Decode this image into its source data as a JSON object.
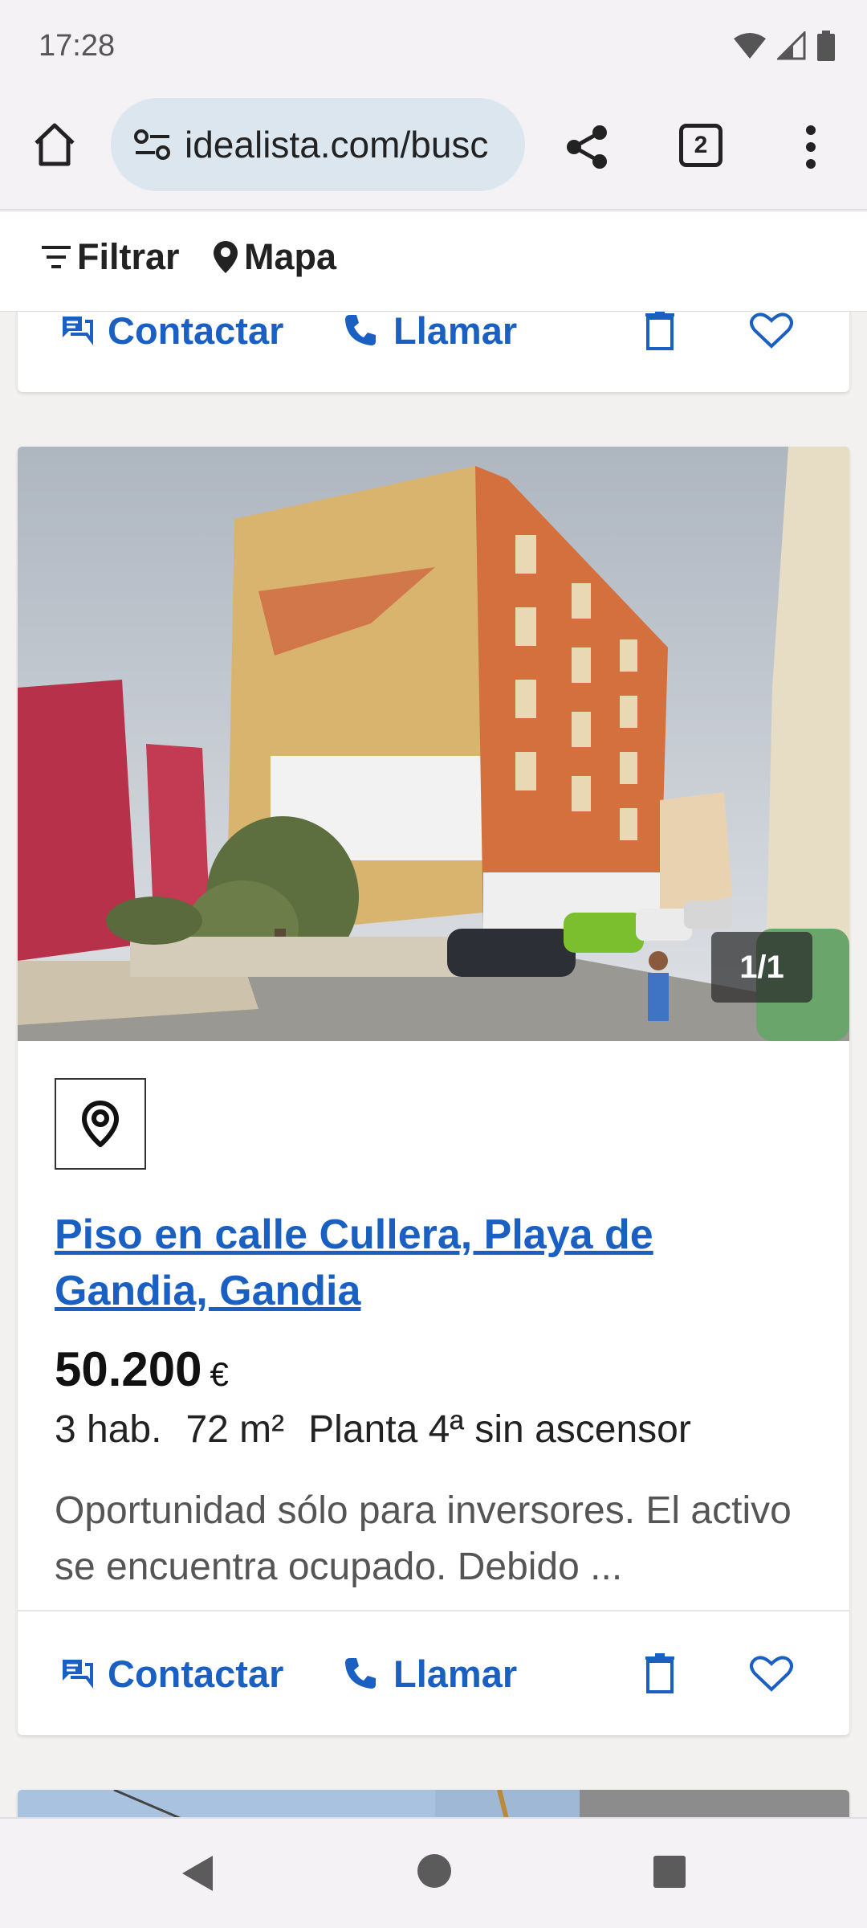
{
  "status_bar": {
    "time": "17:28"
  },
  "browser": {
    "url": "idealista.com/busc",
    "tab_count": "2"
  },
  "filter_bar": {
    "filter_label": "Filtrar",
    "map_label": "Mapa"
  },
  "previous_card": {
    "contact_label": "Contactar",
    "call_label": "Llamar"
  },
  "listing": {
    "photo_counter": "1/1",
    "title": "Piso en calle Cullera, Playa de Gandia, Gandia",
    "price": "50.200",
    "currency": "€",
    "rooms": "3 hab.",
    "area": "72 m²",
    "floor": "Planta 4ª sin ascensor",
    "description": "Oportunidad sólo para inversores. El activo se encuentra ocupado. Debido ...",
    "contact_label": "Contactar",
    "call_label": "Llamar"
  },
  "colors": {
    "link_blue": "#1a5fc2",
    "pill_bg": "#dbe6ee"
  }
}
